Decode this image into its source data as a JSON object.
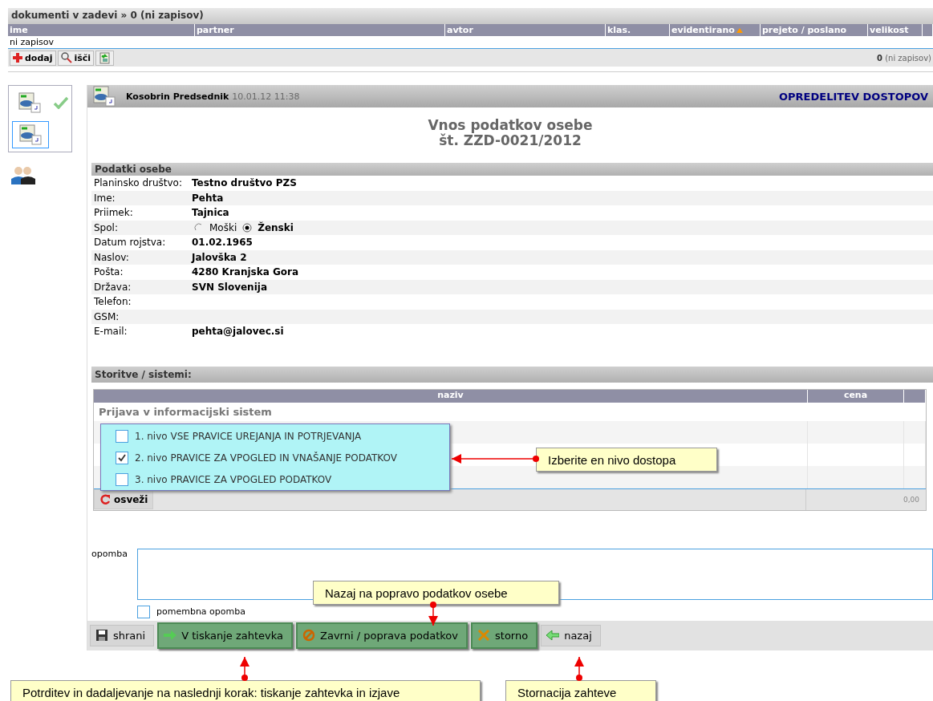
{
  "documents": {
    "title": "dokumenti v zadevi » 0 (ni zapisov)",
    "columns": [
      {
        "label": "ime",
        "sorted": false
      },
      {
        "label": "partner",
        "sorted": false
      },
      {
        "label": "avtor",
        "sorted": false
      },
      {
        "label": "klas.",
        "sorted": false
      },
      {
        "label": "evidentirano",
        "sorted": true
      },
      {
        "label": "prejeto / poslano",
        "sorted": false
      },
      {
        "label": "velikost",
        "sorted": false
      }
    ],
    "empty_text": "ni zapisov",
    "toolbar": [
      {
        "kind": "add",
        "label": "dodaj"
      },
      {
        "kind": "search",
        "label": "išči"
      },
      {
        "kind": "export"
      }
    ],
    "count": "0",
    "count_note": "(ni zapisov)"
  },
  "sidebar": {
    "steps": [
      {
        "selected": false,
        "checked": true
      },
      {
        "selected": true,
        "checked": false
      }
    ]
  },
  "panel": {
    "author": "Kosobrin Predsednik",
    "timestamp": "10.01.12 11:38",
    "section_title": "OPREDELITEV DOSTOPOV",
    "title": "Vnos podatkov osebe",
    "number": "št. ZZD-0021/2012",
    "person": {
      "title": "Podatki osebe",
      "fields": [
        {
          "kind": "text",
          "label": "Planinsko društvo:",
          "value": "Testno društvo PZS"
        },
        {
          "kind": "text",
          "label": "Ime:",
          "value": "Pehta"
        },
        {
          "kind": "text",
          "label": "Priimek:",
          "value": "Tajnica"
        },
        {
          "kind": "radio",
          "label": "Spol:",
          "options": [
            {
              "label": "Moški",
              "selected": false
            },
            {
              "label": "Ženski",
              "selected": true
            }
          ]
        },
        {
          "kind": "text",
          "label": "Datum rojstva:",
          "value": "01.02.1965"
        },
        {
          "kind": "text",
          "label": "Naslov:",
          "value": "Jalovška 2"
        },
        {
          "kind": "text",
          "label": "Pošta:",
          "value": "4280 Kranjska Gora"
        },
        {
          "kind": "text",
          "label": "Država:",
          "value": "SVN Slovenija"
        },
        {
          "kind": "text",
          "label": "Telefon:"
        },
        {
          "kind": "text",
          "label": "GSM:"
        },
        {
          "kind": "text",
          "label": "E-mail:",
          "value": "pehta@jalovec.si"
        }
      ]
    },
    "services": {
      "title": "Storitve / sistemi:",
      "columns": [
        "naziv",
        "cena"
      ],
      "group": "Prijava v informacijski sistem",
      "levels": [
        {
          "label": "1. nivo VSE PRAVICE UREJANJA IN POTRJEVANJA",
          "checked": false
        },
        {
          "label": "2. nivo PRAVICE ZA VPOGLED IN VNAŠANJE PODATKOV",
          "checked": true
        },
        {
          "label": "3. nivo PRAVICE ZA VPOGLED PODATKOV",
          "checked": false
        }
      ],
      "refresh": "osveži",
      "total": "0,00"
    },
    "note": {
      "label": "opomba",
      "important_label": "pomembna opomba",
      "important": false
    },
    "buttons": [
      {
        "kind": "save",
        "label": "shrani",
        "highlighted": false
      },
      {
        "kind": "forward",
        "label": "V tiskanje zahtevka",
        "highlighted": true
      },
      {
        "kind": "block",
        "label": "Zavrni / poprava podatkov",
        "highlighted": true
      },
      {
        "kind": "cancel",
        "label": "storno",
        "highlighted": true
      },
      {
        "kind": "back",
        "label": "nazaj",
        "highlighted": false
      }
    ]
  },
  "callouts": [
    "Izberite en nivo dostopa",
    "Nazaj na popravo podatkov osebe",
    "Potrditev in dadaljevanje na naslednji korak: tiskanje zahtevka in izjave",
    "Stornacija zahteve"
  ]
}
